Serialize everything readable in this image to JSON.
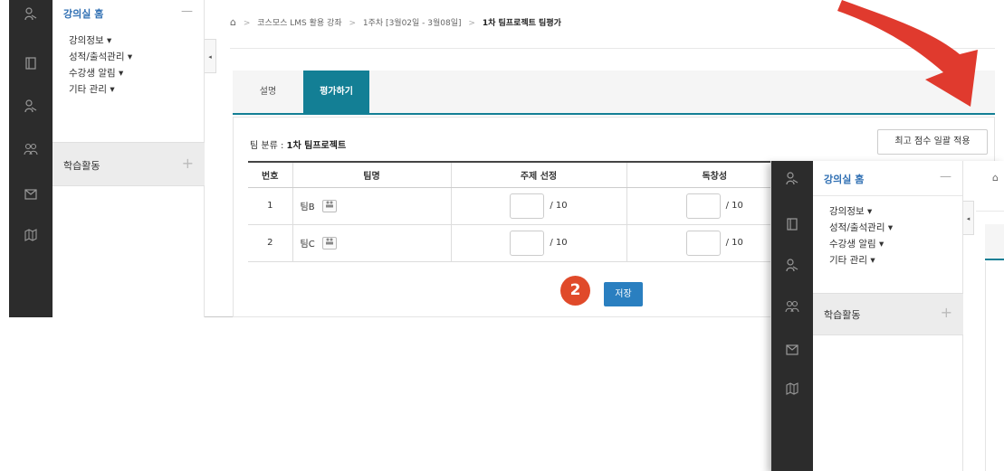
{
  "sidebar": {
    "home_label": "강의실 홈",
    "home_toggle": "—",
    "menu": [
      "강의정보 ▾",
      "성적/출석관리 ▾",
      "수강생 알림 ▾",
      "기타 관리 ▾"
    ],
    "activity_label": "학습활동",
    "activity_toggle": "+",
    "collapse_glyph": "◂"
  },
  "rail_icons": [
    "person-teacher-icon",
    "book-icon",
    "person-student-icon",
    "group-icon",
    "mail-icon",
    "map-icon"
  ],
  "breadcrumb": {
    "home_glyph": "⌂",
    "separator": ">",
    "items": [
      "코스모스 LMS 활용 강좌",
      "1주차 [3월02일 - 3월08일]"
    ],
    "current": "1차 팀프로젝트 팀평가"
  },
  "tabs": [
    "설명",
    "평가하기"
  ],
  "team_category": {
    "label": "팀 분류 : ",
    "value": "1차 팀프로젝트"
  },
  "bulk_button": "최고 점수 일괄 적용",
  "table": {
    "headers": [
      "번호",
      "팀명",
      "주제 선정",
      "독창성"
    ],
    "rows": [
      {
        "no": "1",
        "team": "팀B",
        "scores": [
          "/ 10",
          "/ 10"
        ]
      },
      {
        "no": "2",
        "team": "팀C",
        "scores": [
          "/ 10",
          "/ 10"
        ]
      }
    ]
  },
  "step_badge": "2",
  "save_button": "저장",
  "colors": {
    "accent_teal": "#137f95",
    "save_blue": "#2a7fc0",
    "badge_red": "#e04a2a",
    "link_blue": "#2f6fb3",
    "rail_dark": "#2c2c2c",
    "arrow_red": "#e03a2e"
  }
}
